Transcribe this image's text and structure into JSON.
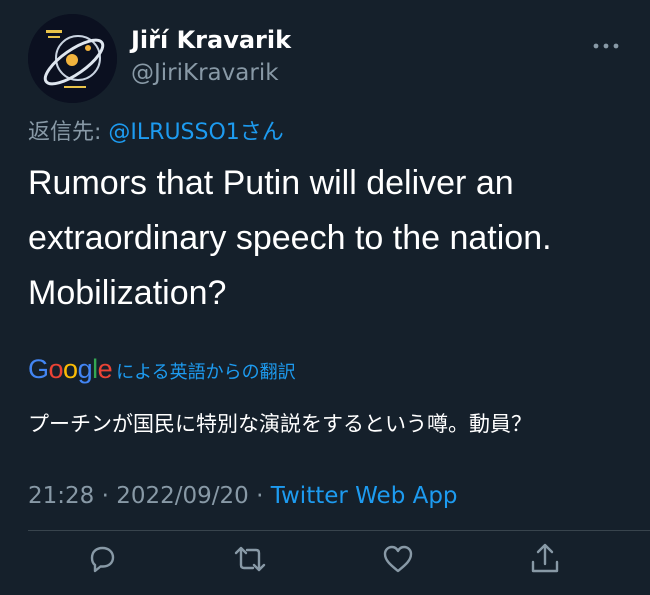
{
  "author": {
    "display_name": "Jiří Kravarik",
    "handle": "@JiriKravarik"
  },
  "reply": {
    "prefix": "返信先: ",
    "mention": "@ILRUSSO1",
    "suffix": "さん"
  },
  "tweet": {
    "text": "Rumors that Putin will deliver an\nextraordinary speech to the nation.\nMobilization?"
  },
  "translation": {
    "provider_logo": "Google",
    "link_text": "による英語からの翻訳",
    "text": "プーチンが国民に特別な演説をするという噂。動員？"
  },
  "meta": {
    "time": "21:28",
    "separator": " · ",
    "date": "2022/09/20",
    "source": "Twitter Web App"
  },
  "actions": [
    {
      "icon": "reply-icon"
    },
    {
      "icon": "retweet-icon"
    },
    {
      "icon": "like-icon"
    },
    {
      "icon": "share-icon"
    }
  ],
  "colors": {
    "background": "#15202b",
    "secondary_text": "#8899a6",
    "accent": "#1d9bf0",
    "divider": "#38444d"
  }
}
